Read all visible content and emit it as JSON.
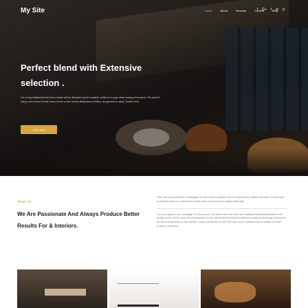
{
  "site": {
    "name": "My Site"
  },
  "nav": {
    "items": [
      "Home",
      "About",
      "Services",
      "Contact",
      "Blog"
    ],
    "active_index": 0
  },
  "social": {
    "icons": [
      "f",
      "G+",
      "t",
      "in",
      "p"
    ]
  },
  "hero": {
    "title": "Perfect blend with Extensive selection .",
    "text": "It is a long established fact that a reader will be distracted by the readable content of a page when looking at its layout. The point of using Lorem Ipsum is that it has a more-or-less normal distribution of letters, as opposed to using 'Content here.",
    "button_label": "Learn More"
  },
  "about": {
    "label": "About Us",
    "heading": "We Are Passionate And Always Produce Better Results For & Interiors.",
    "paragraph1": "There are many variations of passages of Lorem Ipsum available, but the majority have suffered alteration in some form, by injected humour, or randomised words which don't look even slightly believable.",
    "paragraph2": "If you are going to use a passage of Lorem Ipsum, you need to be sure there isn't anything embarrassing hidden in the middle of text. All the Lorem Ipsum generators on the Internet tend to repeat predefined chunks as necessary, making this the first true generator on the Internet. It uses a dictionary of over 200 Latin words, combined with a handful of model sentence structures."
  },
  "colors": {
    "accent": "#d7a53e",
    "dark": "#1c1c1c"
  }
}
